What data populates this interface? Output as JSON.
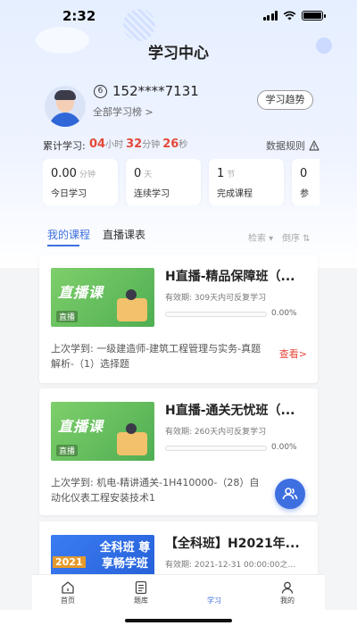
{
  "status_bar": {
    "time": "2:32"
  },
  "header": {
    "title": "学习中心"
  },
  "profile": {
    "level": "6",
    "phone": "152****7131",
    "rank_link": "全部学习榜 >",
    "trend_button": "学习趋势"
  },
  "cumulative": {
    "label": "累计学习:",
    "hours": "04",
    "hours_unit": "小时",
    "minutes": "32",
    "minutes_unit": "分钟",
    "seconds": "26",
    "seconds_unit": "秒",
    "rules": "数据规则"
  },
  "stats": [
    {
      "value": "0.00",
      "unit": "分钟",
      "label": "今日学习"
    },
    {
      "value": "0",
      "unit": "天",
      "label": "连续学习"
    },
    {
      "value": "1",
      "unit": "节",
      "label": "完成课程"
    },
    {
      "value": "0",
      "unit": "",
      "label": "参"
    }
  ],
  "tabs": {
    "my_courses": "我的课程",
    "live_courses": "直播课表",
    "search": "检索",
    "reverse": "倒序"
  },
  "courses": [
    {
      "title": "H直播-精品保障班（...",
      "cover_text": "直播课",
      "cover_tag": "直播",
      "validity": "有效期: 309天内可反复学习",
      "progress": "0.00%",
      "progress_fraction": 0,
      "last_studied": "上次学到: 一级建造师-建筑工程管理与实务-真题解析-（1）选择题",
      "view": "查看>"
    },
    {
      "title": "H直播-通关无忧班（...",
      "cover_text": "直播课",
      "cover_tag": "直播",
      "validity": "有效期: 260天内可反复学习",
      "progress": "0.00%",
      "progress_fraction": 0,
      "last_studied": "上次学到: 机电-精讲通关-1H410000-（28）自动化仪表工程安装技术1"
    },
    {
      "title": "【全科班】H2021年...",
      "cover_text": "全科班 尊享畅学班",
      "cover_year": "2021",
      "validity": "有效期: 2021-12-31 00:00:00之..."
    }
  ],
  "bottom_nav": [
    {
      "label": "首页",
      "icon": "home-icon"
    },
    {
      "label": "题库",
      "icon": "question-bank-icon"
    },
    {
      "label": "学习",
      "icon": "study-icon"
    },
    {
      "label": "我的",
      "icon": "profile-icon"
    }
  ],
  "accent_color": "#3e6fe0",
  "highlight_color": "#e4493a"
}
